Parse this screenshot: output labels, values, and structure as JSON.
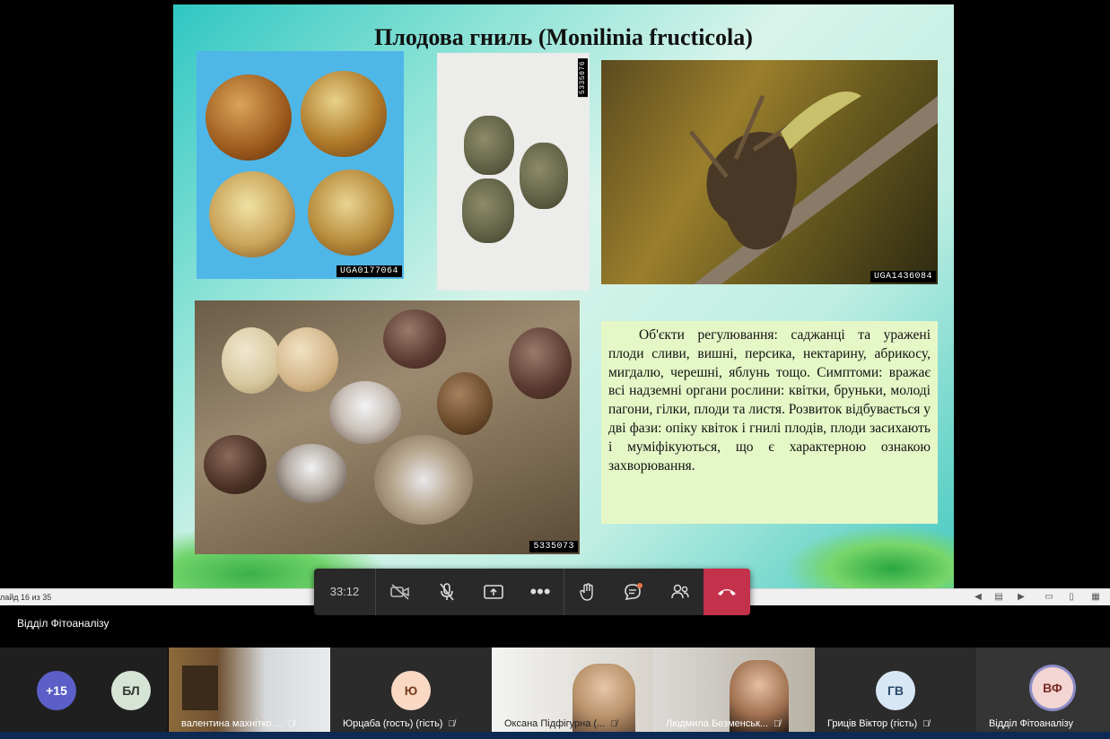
{
  "slide": {
    "title": "Плодова гниль (Monilinia fructicola)",
    "photo_tags": {
      "tl": "UGA0177064",
      "tm": "5335076",
      "tr": "UGA1436084",
      "bl": "5335073"
    },
    "text": "Об'єкти регулювання: саджанці та уражені плоди сливи, вишні, персика, нектарину, абрикосу, мигдалю, черешні, яблунь тощо. Симптоми: вражає всі надземні органи рослини: квітки, бруньки, молоді пагони, гілки, плоди та листя. Розвиток відбувається у дві фази: опіку квіток і гнилі плодів, плоди засихають і муміфікуються, що є характерною ознакою захворювання."
  },
  "statusbar": {
    "slide_counter": "лайд 16 из 35"
  },
  "controls": {
    "timer": "33:12",
    "buttons": [
      "camera-off-icon",
      "mic-off-icon",
      "share-icon",
      "more-icon",
      "raise-hand-icon",
      "chat-icon",
      "people-icon",
      "hangup-icon"
    ]
  },
  "meeting": {
    "title": "Відділ Фітоаналізу"
  },
  "participants": [
    {
      "initials": "+15",
      "color": "#5b5fc7"
    },
    {
      "initials": "БЛ",
      "color": "#d6e4d5"
    },
    {
      "name": "валентина махнітко ...",
      "video": true
    },
    {
      "initials": "Ю",
      "name": "Юрцаба (гость) (гість)",
      "color": "#f9d9c4"
    },
    {
      "name": "Оксана Підфігурна (...",
      "video": true
    },
    {
      "name": "Людмила Безменськ...",
      "video": true
    },
    {
      "initials": "ГВ",
      "name": "Гриців Віктор (гість)",
      "color": "#d7e7f5"
    },
    {
      "initials": "ВФ",
      "name": "Відділ Фітоаналізу",
      "color": "#f3d6d3"
    }
  ]
}
